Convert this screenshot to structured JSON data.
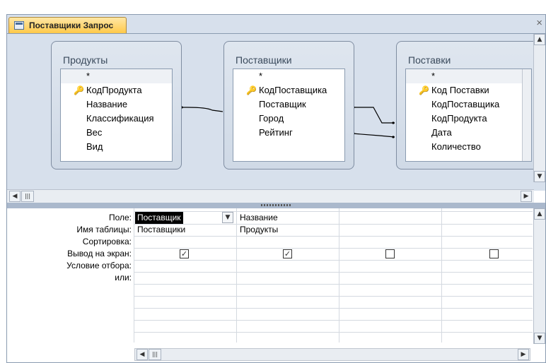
{
  "tab": {
    "title": "Поставщики Запрос",
    "close": "×"
  },
  "tables": [
    {
      "title": "Продукты",
      "fields": [
        "*",
        "КодПродукта",
        "Название",
        "Классификация",
        "Вес",
        "Вид"
      ],
      "key_index": 1
    },
    {
      "title": "Поставщики",
      "fields": [
        "*",
        "КодПоставщика",
        "Поставщик",
        "Город",
        "Рейтинг"
      ],
      "key_index": 1
    },
    {
      "title": "Поставки",
      "fields": [
        "*",
        "Код Поставки",
        "КодПоставщика",
        "КодПродукта",
        "Дата",
        "Количество"
      ],
      "key_index": 1
    }
  ],
  "grid": {
    "row_labels": [
      "Поле:",
      "Имя таблицы:",
      "Сортировка:",
      "Вывод на экран:",
      "Условие отбора:",
      "или:"
    ],
    "columns": [
      {
        "field": "Поставщик",
        "table": "Поставщики",
        "show": true
      },
      {
        "field": "Название",
        "table": "Продукты",
        "show": true
      },
      {
        "field": "",
        "table": "",
        "show": false
      },
      {
        "field": "",
        "table": "",
        "show": false
      }
    ]
  },
  "icons": {
    "key": "key-icon",
    "check": "check-icon",
    "dropdown": "chevron-down-icon",
    "scroll_up": "arrow-up-icon",
    "scroll_down": "arrow-down-icon",
    "scroll_left": "arrow-left-icon",
    "scroll_right": "arrow-right-icon"
  }
}
